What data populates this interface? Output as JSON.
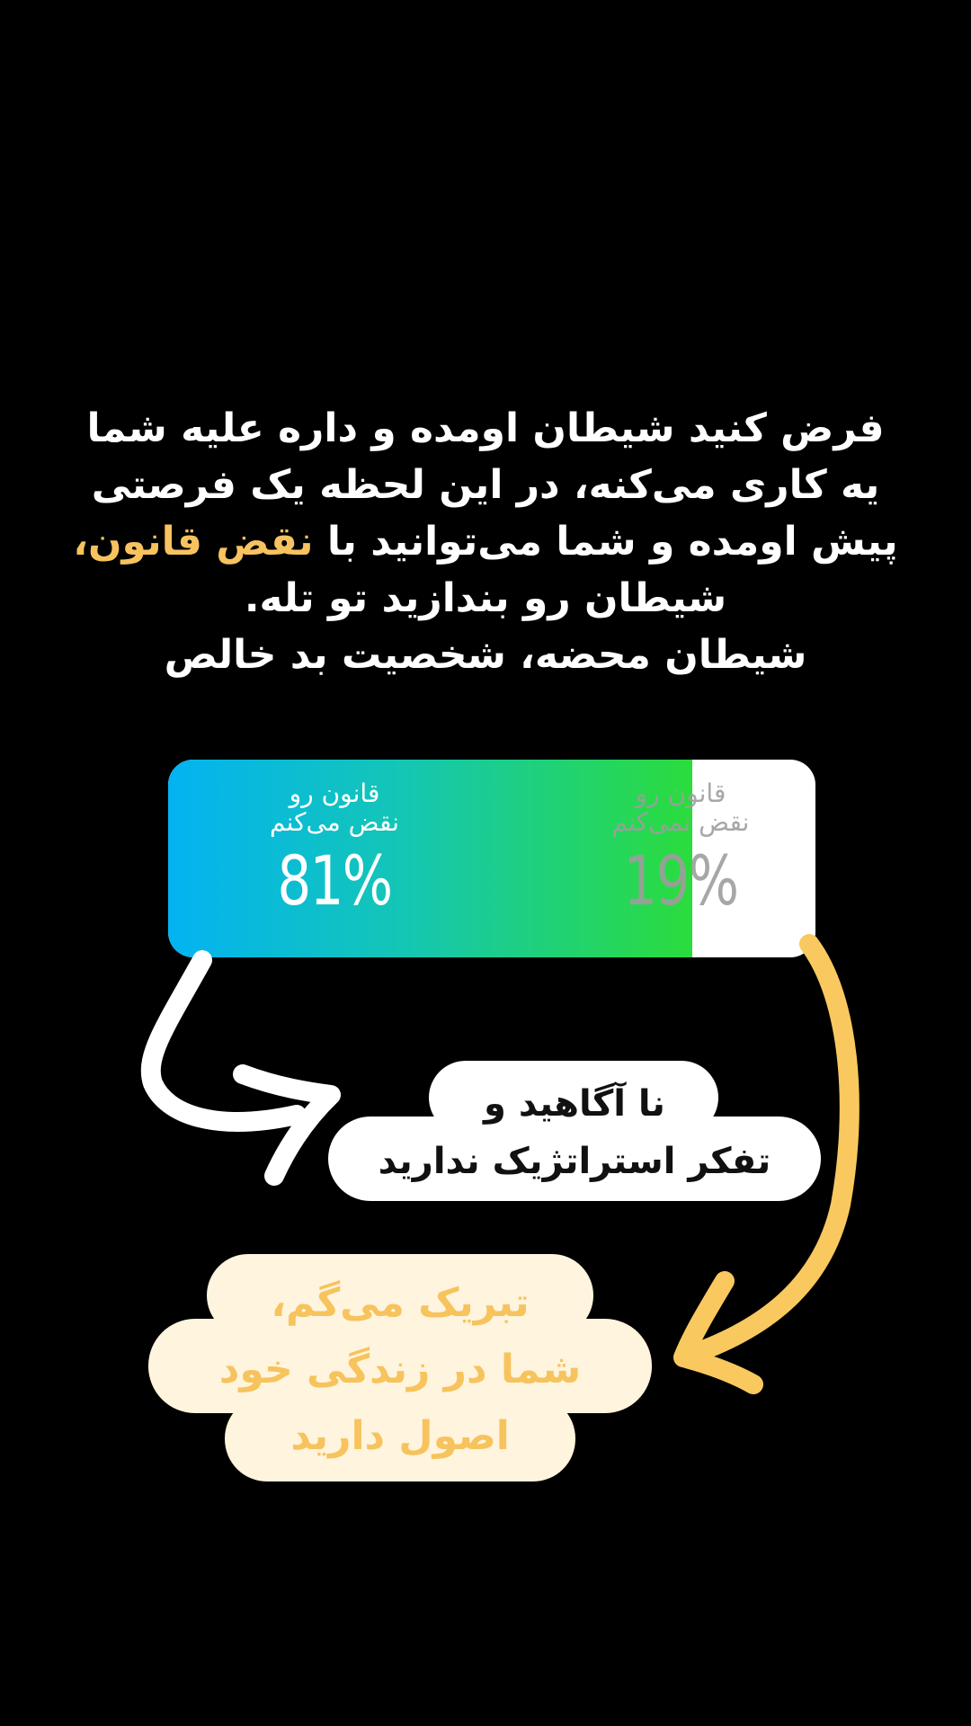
{
  "question": {
    "lines": [
      "فرض کنید شیطان اومده و داره علیه شما",
      "یه کاری می‌کنه، در این لحظه یک فرصتی",
      "پیش اومده و شما می‌توانید با",
      "شیطان رو بندازید تو تله.",
      "شیطان محضه، شخصیت بد خالص"
    ],
    "highlight": "نقض قانون،",
    "highlight_color": "#f7c35f"
  },
  "poll": {
    "options": [
      {
        "label_line1": "قانون رو",
        "label_line2": "نقض می‌کنم",
        "percent_text": "81%",
        "percent": 81
      },
      {
        "label_line1": "قانون رو",
        "label_line2": "نقض نمی‌کنم",
        "percent_text": "19%",
        "percent": 19
      }
    ],
    "gradient_colors": [
      "#03b3f2",
      "#2bdc3c"
    ]
  },
  "bubble_white": {
    "line1": "نا آگاهید و",
    "line2": "تفکر استراتژیک ندارید"
  },
  "bubble_cream": {
    "line1": "تبریک می‌گم،",
    "line2": "شما در زندگی خود",
    "line3": "اصول دارید",
    "text_color": "#f6c35d",
    "background": "#fff4dd"
  },
  "arrows": [
    {
      "name": "white-arrow",
      "color": "#ffffff"
    },
    {
      "name": "yellow-arrow",
      "color": "#f9c95f"
    }
  ]
}
